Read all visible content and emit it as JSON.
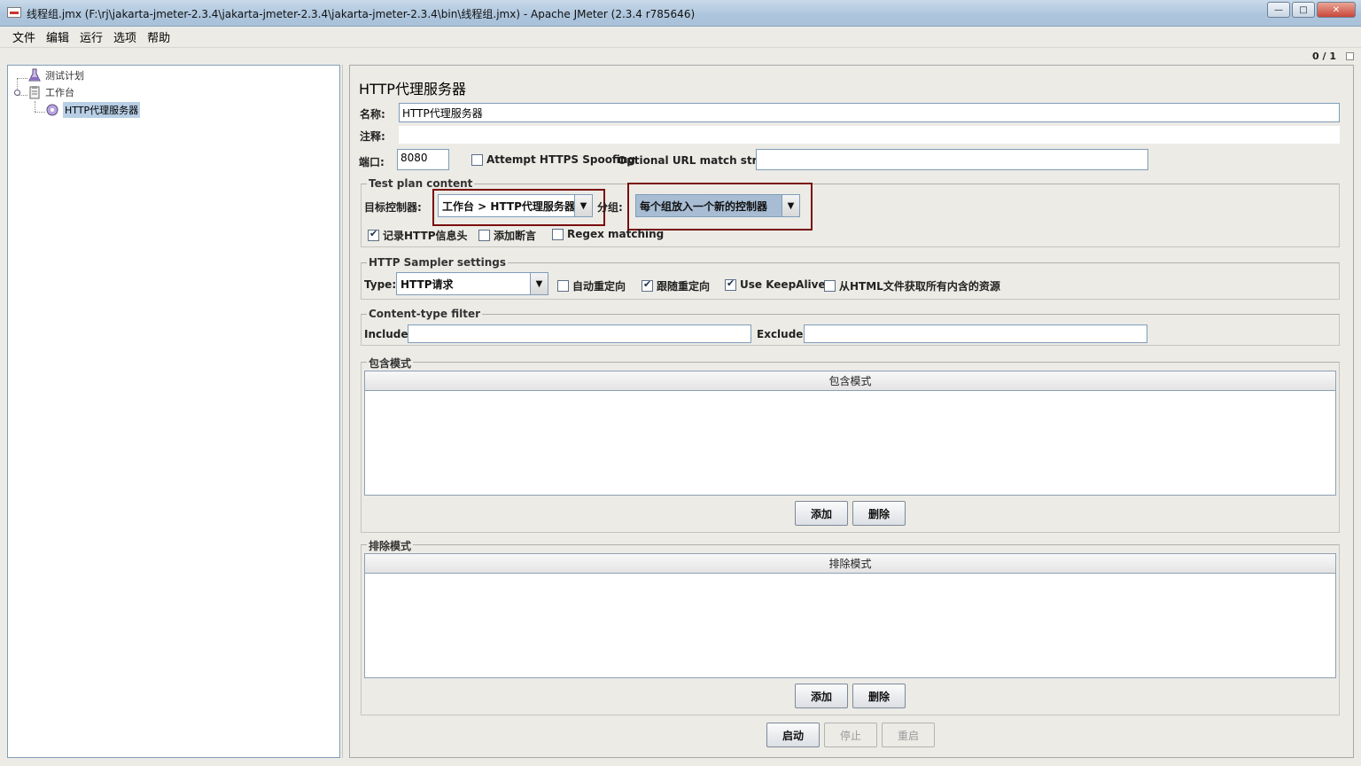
{
  "window": {
    "title": "线程组.jmx (F:\\rj\\jakarta-jmeter-2.3.4\\jakarta-jmeter-2.3.4\\jakarta-jmeter-2.3.4\\bin\\线程组.jmx) - Apache JMeter (2.3.4 r785646)",
    "minimize": "—",
    "maximize": "□",
    "close": "✕"
  },
  "menu": [
    "文件",
    "编辑",
    "运行",
    "选项",
    "帮助"
  ],
  "status": {
    "counter": "0 / 1"
  },
  "tree": {
    "items": [
      {
        "label": "测试计划",
        "icon": "flask-icon"
      },
      {
        "label": "工作台",
        "icon": "clipboard-icon"
      },
      {
        "label": "HTTP代理服务器",
        "icon": "proxy-icon",
        "selected": true
      }
    ]
  },
  "panel": {
    "title": "HTTP代理服务器",
    "name_label": "名称:",
    "name_value": "HTTP代理服务器",
    "comment_label": "注释:",
    "comment_value": "",
    "port_label": "端口:",
    "port_value": "8080",
    "https_spoofing_label": "Attempt HTTPS Spoofing",
    "https_spoofing_checked": false,
    "url_match_label": "Optional URL match string:",
    "url_match_value": "",
    "test_plan": {
      "title": "Test plan content",
      "target_label": "目标控制器:",
      "target_value": "工作台 > HTTP代理服务器",
      "grouping_label": "分组:",
      "grouping_value": "每个组放入一个新的控制器",
      "record_headers_label": "记录HTTP信息头",
      "record_headers_checked": true,
      "add_assertions_label": "添加断言",
      "add_assertions_checked": false,
      "regex_label": "Regex matching",
      "regex_checked": false
    },
    "sampler": {
      "title": "HTTP Sampler settings",
      "type_label": "Type:",
      "type_value": "HTTP请求",
      "auto_redirect_label": "自动重定向",
      "auto_redirect_checked": false,
      "follow_redirect_label": "跟随重定向",
      "follow_redirect_checked": true,
      "keepalive_label": "Use KeepAlive",
      "keepalive_checked": true,
      "embedded_label": "从HTML文件获取所有内含的资源",
      "embedded_checked": false
    },
    "content_filter": {
      "title": "Content-type filter",
      "include_label": "Include:",
      "include_value": "",
      "exclude_label": "Exclude:",
      "exclude_value": ""
    },
    "include_patterns": {
      "title": "包含模式",
      "column": "包含模式",
      "add": "添加",
      "delete": "删除"
    },
    "exclude_patterns": {
      "title": "排除模式",
      "column": "排除模式",
      "add": "添加",
      "delete": "删除"
    },
    "buttons": {
      "start": "启动",
      "stop": "停止",
      "restart": "重启"
    }
  }
}
